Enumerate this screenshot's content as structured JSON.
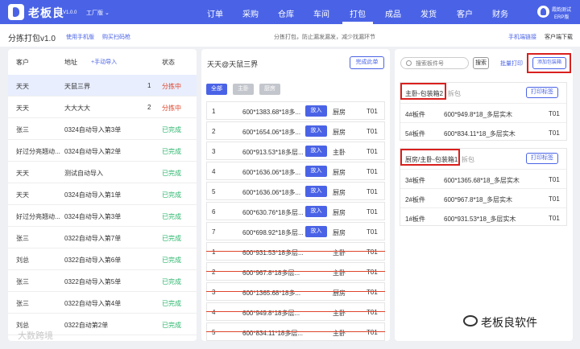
{
  "app": {
    "brand": "老板良",
    "version": "V1.0.0",
    "workspace": "工厂版"
  },
  "nav": [
    "订单",
    "采购",
    "仓库",
    "车间",
    "打包",
    "成品",
    "发货",
    "客户",
    "财务"
  ],
  "user": {
    "name": "霞韵测试",
    "role": "ERP版"
  },
  "subheader": {
    "title": "分拣打包v1.0",
    "link1": "使用手机版",
    "link2": "购买扫码枪",
    "hint": "分拣打包，防止漏发漏发，减少找漏环节",
    "right1": "手机端链接",
    "right2": "客户端下载"
  },
  "customers": {
    "col_customer": "客户",
    "col_address": "地址",
    "import_label": "+手动导入",
    "col_status": "状态",
    "rows": [
      {
        "customer": "天天",
        "address": "天鼠三界",
        "count": "1",
        "status": "分拣中",
        "status_type": "red",
        "selected": true
      },
      {
        "customer": "天天",
        "address": "大大大大",
        "count": "2",
        "status": "分拣中",
        "status_type": "red",
        "selected": false
      },
      {
        "customer": "张三",
        "address": "0324自动导入第3单",
        "count": "",
        "status": "已完成",
        "status_type": "green",
        "selected": false
      },
      {
        "customer": "好过分亮翘动...",
        "address": "0324自动导入第2单",
        "count": "",
        "status": "已完成",
        "status_type": "green",
        "selected": false
      },
      {
        "customer": "天天",
        "address": "测试自动导入",
        "count": "",
        "status": "已完成",
        "status_type": "green",
        "selected": false
      },
      {
        "customer": "天天",
        "address": "0324自动导入第1单",
        "count": "",
        "status": "已完成",
        "status_type": "green",
        "selected": false
      },
      {
        "customer": "好过分亮翘动...",
        "address": "0324自动导入第3单",
        "count": "",
        "status": "已完成",
        "status_type": "green",
        "selected": false
      },
      {
        "customer": "张三",
        "address": "0322自动导入第7单",
        "count": "",
        "status": "已完成",
        "status_type": "green",
        "selected": false
      },
      {
        "customer": "刘总",
        "address": "0322自动导入第6单",
        "count": "",
        "status": "已完成",
        "status_type": "green",
        "selected": false
      },
      {
        "customer": "张三",
        "address": "0322自动导入第5单",
        "count": "",
        "status": "已完成",
        "status_type": "green",
        "selected": false
      },
      {
        "customer": "张三",
        "address": "0322自动导入第4单",
        "count": "",
        "status": "已完成",
        "status_type": "green",
        "selected": false
      },
      {
        "customer": "刘总",
        "address": "0322自动第2单",
        "count": "",
        "status": "已完成",
        "status_type": "green",
        "selected": false
      }
    ]
  },
  "order": {
    "title": "天天@天鼠三界",
    "complete_label": "完成此单",
    "filters": [
      {
        "label": "全部",
        "color": "#4a63e6"
      },
      {
        "label": "主卧",
        "color": "#c3c6cc"
      },
      {
        "label": "厨房",
        "color": "#c3c6cc"
      }
    ],
    "put_label": "放入",
    "items": [
      {
        "no": "1",
        "spec": "600*1383.68*18多...",
        "room": "厨房",
        "code": "T01",
        "done": false
      },
      {
        "no": "2",
        "spec": "600*1654.06*18多...",
        "room": "厨房",
        "code": "T01",
        "done": false
      },
      {
        "no": "3",
        "spec": "600*913.53*18多层...",
        "room": "主卧",
        "code": "T01",
        "done": false
      },
      {
        "no": "4",
        "spec": "600*1636.06*18多...",
        "room": "厨房",
        "code": "T01",
        "done": false
      },
      {
        "no": "5",
        "spec": "600*1636.06*18多...",
        "room": "厨房",
        "code": "T01",
        "done": false
      },
      {
        "no": "6",
        "spec": "600*630.76*18多层...",
        "room": "厨房",
        "code": "T01",
        "done": false
      },
      {
        "no": "7",
        "spec": "600*698.92*18多层...",
        "room": "厨房",
        "code": "T01",
        "done": false
      },
      {
        "no": "1",
        "spec": "600*931.53*18多层...",
        "room": "主卧",
        "code": "T01",
        "done": true
      },
      {
        "no": "2",
        "spec": "600*967.8*18多层...",
        "room": "主卧",
        "code": "T01",
        "done": true
      },
      {
        "no": "3",
        "spec": "600*1365.68*18多...",
        "room": "厨房",
        "code": "T01",
        "done": true
      },
      {
        "no": "4",
        "spec": "600*949.8*18多层...",
        "room": "主卧",
        "code": "T01",
        "done": true
      },
      {
        "no": "5",
        "spec": "600*834.11*18多层...",
        "room": "主卧",
        "code": "T01",
        "done": true
      }
    ]
  },
  "packages": {
    "search_placeholder": "搜索板件号",
    "search_btn": "搜索",
    "batch_print": "批量打印",
    "add_pkg": "添加包装箱",
    "print_label": "打印标签",
    "boxes": [
      {
        "title": "主卧-包装箱2",
        "tag": "拆包",
        "items": [
          {
            "no": "4#板件",
            "spec": "600*949.8*18_多层实木",
            "code": "T01"
          },
          {
            "no": "5#板件",
            "spec": "600*834.11*18_多层实木",
            "code": "T01"
          }
        ]
      },
      {
        "title": "厨房/主卧-包装箱1",
        "tag": "拆包",
        "items": [
          {
            "no": "3#板件",
            "spec": "600*1365.68*18_多层实木",
            "code": "T01"
          },
          {
            "no": "2#板件",
            "spec": "600*967.8*18_多层实木",
            "code": "T01"
          },
          {
            "no": "1#板件",
            "spec": "600*931.53*18_多层实木",
            "code": "T01"
          }
        ]
      }
    ]
  },
  "watermarks": {
    "left": "大数跨境",
    "right": "老板良软件"
  }
}
